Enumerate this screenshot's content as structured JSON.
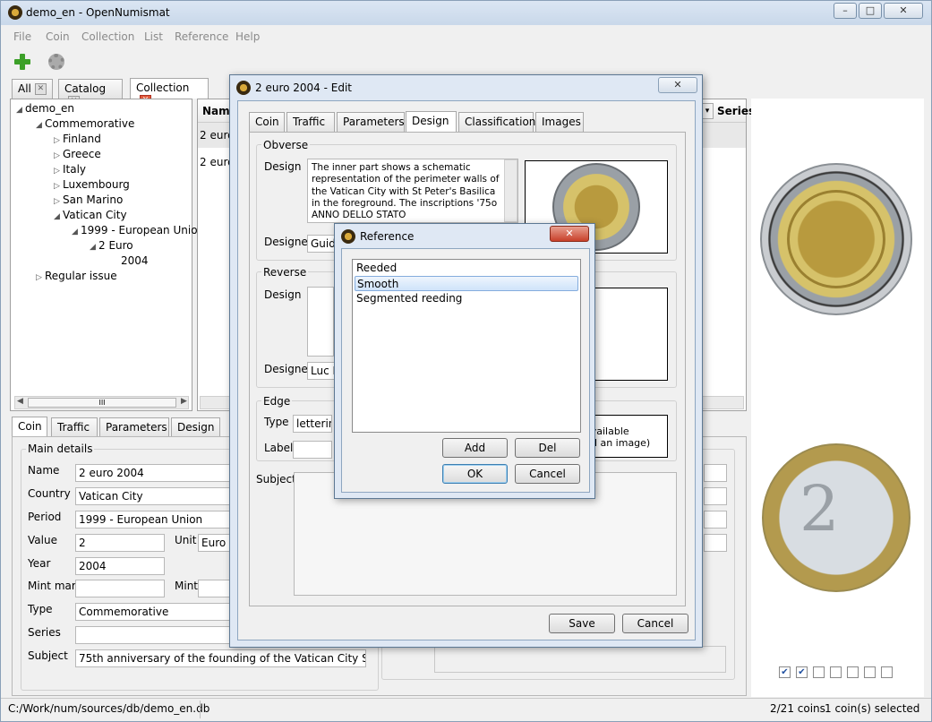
{
  "window": {
    "title": "demo_en - OpenNumismat",
    "min": "–",
    "max": "□",
    "close": "✕"
  },
  "menu": [
    "File",
    "Coin",
    "Collection",
    "List",
    "Reference",
    "Help"
  ],
  "tabs": [
    "All",
    "Catalog",
    "Collection"
  ],
  "tree": {
    "root": "demo_en",
    "commemorative": "Commemorative",
    "countries": [
      "Finland",
      "Greece",
      "Italy",
      "Luxembourg",
      "San Marino",
      "Vatican City"
    ],
    "period": "1999 - European Union",
    "value": "2 Euro",
    "year": "2004",
    "regular": "Regular issue"
  },
  "list": {
    "col_name": "Name",
    "col_series": "Series",
    "rows": [
      "2 euro",
      "2 euro"
    ]
  },
  "scroll_grip": "III",
  "detail": {
    "tabs": [
      "Coin",
      "Traffic",
      "Parameters",
      "Design"
    ],
    "group": "Main details",
    "labels": {
      "name": "Name",
      "country": "Country",
      "period": "Period",
      "value": "Value",
      "unit": "Unit",
      "year": "Year",
      "mintmark": "Mint mark",
      "mint": "Mint",
      "type": "Type",
      "series": "Series",
      "subject": "Subject"
    },
    "values": {
      "name": "2 euro 2004",
      "country": "Vatican City",
      "period": "1999 - European Union",
      "value": "2",
      "unit": "Euro",
      "year": "2004",
      "type": "Commemorative",
      "subject": "75th anniversary of the founding of the Vatican City State"
    }
  },
  "edit": {
    "title": "2 euro 2004 - Edit",
    "tabs": [
      "Coin",
      "Traffic",
      "Parameters",
      "Design",
      "Classification",
      "Images"
    ],
    "obverse": {
      "title": "Obverse",
      "design_label": "Design",
      "design_text": "The inner part shows a schematic representation of the perimeter walls of the Vatican City with St Peter's Basilica in the foreground. The inscriptions '75o ANNO DELLO STATO",
      "designer_label": "Designer",
      "designer": "Guido"
    },
    "reverse": {
      "title": "Reverse",
      "design_label": "Design",
      "designer_label": "Designer",
      "designer": "Luc Lu"
    },
    "edge": {
      "title": "Edge",
      "type_label": "Type",
      "type": "lettering",
      "label_label": "Label",
      "image_note1": "available",
      "image_note2": "dd an image)"
    },
    "subject_label": "Subject",
    "save": "Save",
    "cancel": "Cancel"
  },
  "reference": {
    "title": "Reference",
    "items": [
      "Reeded",
      "Smooth",
      "Segmented reeding"
    ],
    "selected": 1,
    "add": "Add",
    "del": "Del",
    "ok": "OK",
    "cancel": "Cancel"
  },
  "checkboxes": [
    true,
    true,
    false,
    false,
    false,
    false,
    false
  ],
  "status": {
    "path": "C:/Work/num/sources/db/demo_en.db",
    "coins": "2/21 coins",
    "selected": "1 coin(s) selected"
  }
}
